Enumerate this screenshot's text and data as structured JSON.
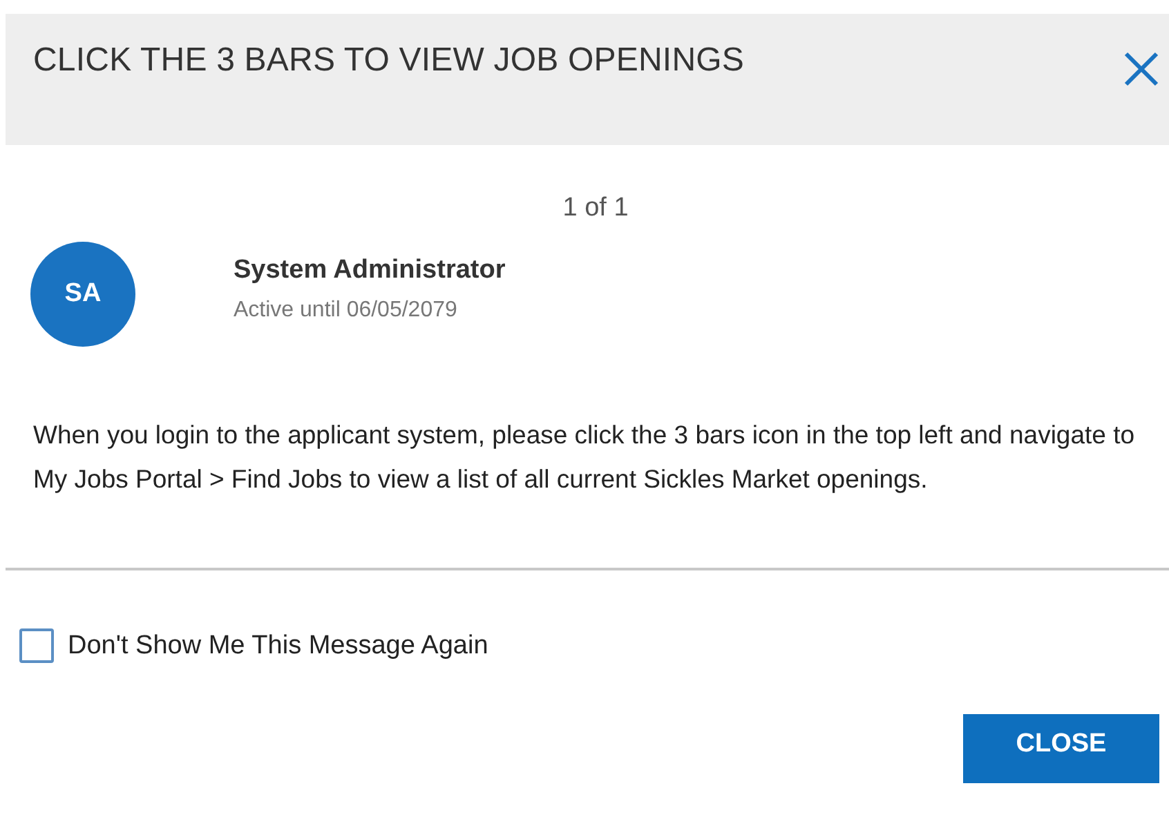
{
  "dialog": {
    "title": "CLICK THE 3 BARS TO VIEW JOB OPENINGS",
    "pager": "1 of 1",
    "sender": {
      "initials": "SA",
      "name": "System Administrator",
      "status": "Active until 06/05/2079"
    },
    "message": "When you login to the applicant system, please click the 3 bars icon in the top left and navigate to My Jobs Portal > Find Jobs to view a list of all current Sickles Market openings.",
    "dont_show_again": {
      "label": "Don't Show Me This Message Again",
      "checked": false
    },
    "buttons": [
      "CLOSE"
    ]
  }
}
